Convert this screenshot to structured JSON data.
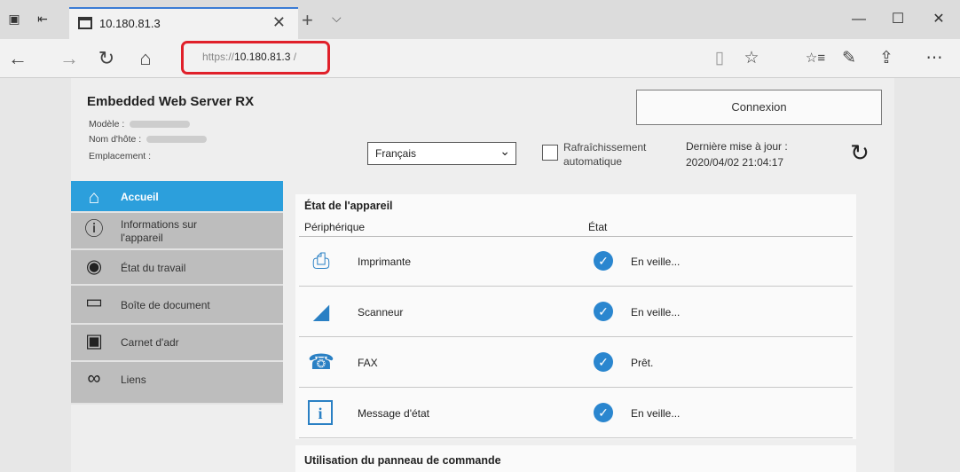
{
  "browser": {
    "tab_title": "10.180.81.3",
    "tab_close": "✕",
    "new_tab": "+",
    "tab_list": "⌵",
    "url_prefix": "https://",
    "url_host": "10.180.81.3",
    "url_suffix": " /",
    "window": {
      "minimize": "—",
      "maximize": "☐",
      "close": "✕"
    },
    "nav": {
      "back": "←",
      "forward": "→",
      "refresh": "↻",
      "home": "⌂"
    },
    "tools": {
      "reading": "▯",
      "favorite": "☆",
      "favorites_hub": "☆≡",
      "notes": "✎",
      "share": "⇪",
      "more": "⋯"
    }
  },
  "header": {
    "title": "Embedded Web Server RX",
    "model_label": "Modèle :",
    "host_label": "Nom d'hôte :",
    "location_label": "Emplacement :",
    "login_label": "Connexion",
    "language_selected": "Français",
    "auto_refresh_line1": "Rafraîchissement",
    "auto_refresh_line2": "automatique",
    "last_update_label": "Dernière mise à jour :",
    "last_update_value": "2020/04/02 21:04:17",
    "reload_icon": "↻"
  },
  "sidebar": {
    "items": [
      {
        "label": "Accueil",
        "icon": "⌂",
        "icon_name": "home-icon"
      },
      {
        "label_line1": "Informations sur",
        "label_line2": "l'appareil",
        "icon": "ⓘ",
        "icon_name": "device-info-icon"
      },
      {
        "label": "État du travail",
        "icon": "◉",
        "icon_name": "eye-icon"
      },
      {
        "label": "Boîte de document",
        "icon": "▭",
        "icon_name": "document-box-icon"
      },
      {
        "label": "Carnet d'adr",
        "icon": "▣",
        "icon_name": "address-book-icon"
      },
      {
        "label": "Liens",
        "icon": "∞",
        "icon_name": "link-icon"
      }
    ]
  },
  "device_status": {
    "title": "État de l'appareil",
    "col_device": "Périphérique",
    "col_status": "État",
    "rows": [
      {
        "name": "Imprimante",
        "status": "En veille...",
        "icon": "⎙",
        "icon_name": "printer-icon"
      },
      {
        "name": "Scanneur",
        "status": "En veille...",
        "icon": "◢",
        "icon_name": "scanner-icon"
      },
      {
        "name": "FAX",
        "status": "Prêt.",
        "icon": "☎",
        "icon_name": "fax-icon"
      },
      {
        "name": "Message d'état",
        "status": "En veille...",
        "icon": "i",
        "icon_name": "info-icon"
      }
    ],
    "check_glyph": "✓"
  },
  "panel_usage": {
    "title": "Utilisation du panneau de commande"
  },
  "colors": {
    "accent": "#2c9fdc",
    "url_highlight": "#e0202a",
    "check": "#2a86cf"
  }
}
